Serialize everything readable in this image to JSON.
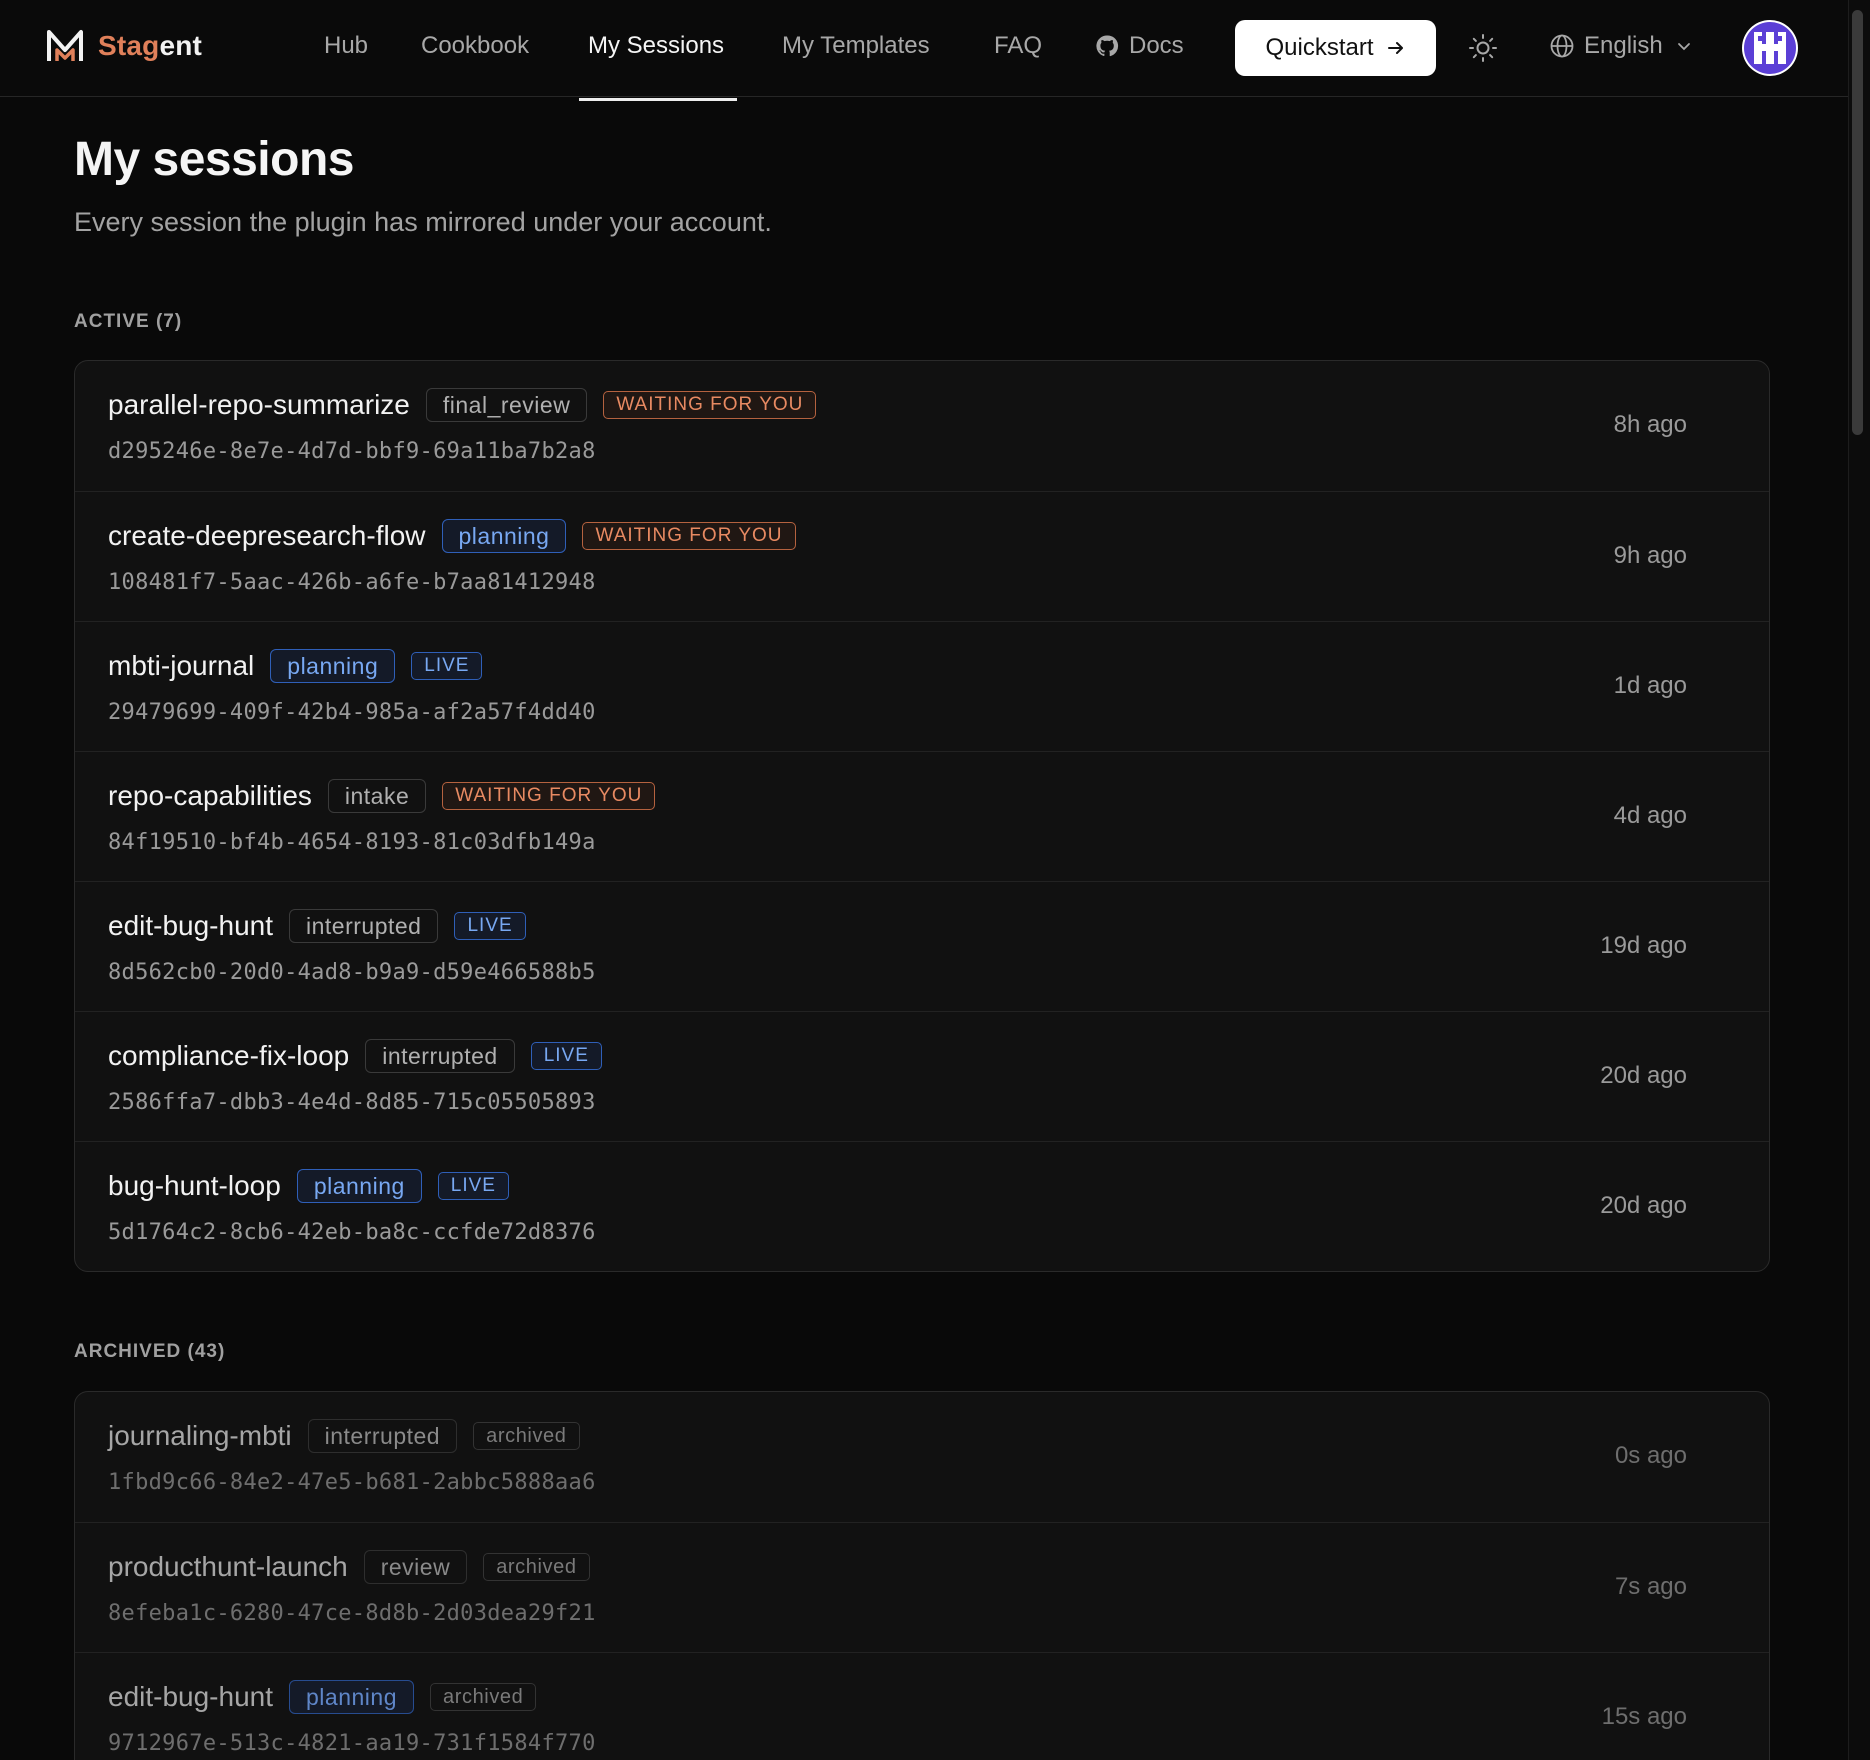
{
  "brand": {
    "part1": "Stag",
    "part2": "ent"
  },
  "nav": {
    "links": [
      "Hub",
      "Cookbook",
      "My Sessions",
      "My Templates",
      "FAQ"
    ],
    "docs": "Docs",
    "quickstart": "Quickstart",
    "language": "English",
    "active_index": 2
  },
  "header": {
    "title": "My sessions",
    "subtitle": "Every session the plugin has mirrored under your account."
  },
  "active": {
    "label": "ACTIVE (7)",
    "sessions": [
      {
        "name": "parallel-repo-summarize",
        "stage": "final_review",
        "status": "WAITING FOR YOU",
        "id": "d295246e-8e7e-4d7d-bbf9-69a11ba7b2a8",
        "time": "8h ago"
      },
      {
        "name": "create-deepresearch-flow",
        "stage": "planning",
        "status": "WAITING FOR YOU",
        "id": "108481f7-5aac-426b-a6fe-b7aa81412948",
        "time": "9h ago"
      },
      {
        "name": "mbti-journal",
        "stage": "planning",
        "status": "LIVE",
        "id": "29479699-409f-42b4-985a-af2a57f4dd40",
        "time": "1d ago"
      },
      {
        "name": "repo-capabilities",
        "stage": "intake",
        "status": "WAITING FOR YOU",
        "id": "84f19510-bf4b-4654-8193-81c03dfb149a",
        "time": "4d ago"
      },
      {
        "name": "edit-bug-hunt",
        "stage": "interrupted",
        "status": "LIVE",
        "id": "8d562cb0-20d0-4ad8-b9a9-d59e466588b5",
        "time": "19d ago"
      },
      {
        "name": "compliance-fix-loop",
        "stage": "interrupted",
        "status": "LIVE",
        "id": "2586ffa7-dbb3-4e4d-8d85-715c05505893",
        "time": "20d ago"
      },
      {
        "name": "bug-hunt-loop",
        "stage": "planning",
        "status": "LIVE",
        "id": "5d1764c2-8cb6-42eb-ba8c-ccfde72d8376",
        "time": "20d ago"
      }
    ]
  },
  "archived": {
    "label": "ARCHIVED (43)",
    "sessions": [
      {
        "name": "journaling-mbti",
        "stage": "interrupted",
        "status": "archived",
        "id": "1fbd9c66-84e2-47e5-b681-2abbc5888aa6",
        "time": "0s ago"
      },
      {
        "name": "producthunt-launch",
        "stage": "review",
        "status": "archived",
        "id": "8efeba1c-6280-47ce-8d8b-2d03dea29f21",
        "time": "7s ago"
      },
      {
        "name": "edit-bug-hunt",
        "stage": "planning",
        "status": "archived",
        "id": "9712967e-513c-4821-aa19-731f1584f770",
        "time": "15s ago"
      }
    ]
  },
  "colors": {
    "brand_accent": "#e0805a",
    "waiting": "#e88a62",
    "live": "#78a8f2",
    "avatar": "#5b3fd6"
  }
}
